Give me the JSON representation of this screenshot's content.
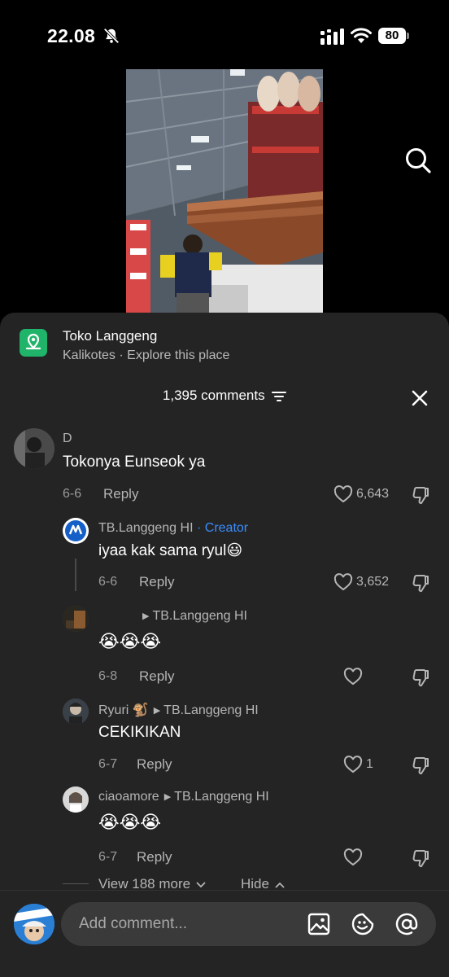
{
  "status": {
    "time": "22.08",
    "battery": "80"
  },
  "place": {
    "name": "Toko Langgeng",
    "subtitle": "Kalikotes · Explore this place"
  },
  "comments_header": {
    "count_label": "1,395 comments"
  },
  "comments": [
    {
      "author": "D",
      "text": "Tokonya Eunseok ya",
      "date": "6-6",
      "reply": "Reply",
      "likes": "6,643"
    },
    {
      "author": "TB.Langgeng HI",
      "creator_label": "· Creator",
      "text": "iyaa kak sama ryul😃",
      "date": "6-6",
      "reply": "Reply",
      "likes": "3,652"
    },
    {
      "author": "",
      "reply_to": "TB.Langgeng HI",
      "text": "😭😭😭",
      "date": "6-8",
      "reply": "Reply",
      "likes": ""
    },
    {
      "author": "Ryuri 🐒",
      "reply_to": "TB.Langgeng HI",
      "text": "CEKIKIKAN",
      "date": "6-7",
      "reply": "Reply",
      "likes": "1"
    },
    {
      "author": "ciaoamore",
      "reply_to": "TB.Langgeng HI",
      "text": "😭😭😭",
      "date": "6-7",
      "reply": "Reply",
      "likes": ""
    }
  ],
  "thread": {
    "view_more": "View 188 more",
    "hide": "Hide"
  },
  "composer": {
    "placeholder": "Add comment..."
  },
  "colors": {
    "accent": "#3a8dff",
    "place_icon": "#20b46a",
    "sheet_bg": "#242424"
  }
}
